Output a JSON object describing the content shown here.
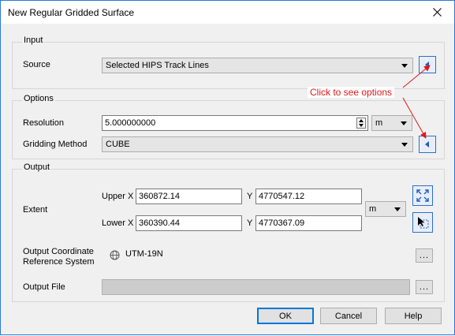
{
  "window": {
    "title": "New Regular Gridded Surface"
  },
  "input": {
    "group_title": "Input",
    "source_label": "Source",
    "source_value": "Selected HIPS Track Lines"
  },
  "options": {
    "group_title": "Options",
    "resolution_label": "Resolution",
    "resolution_value": "5.000000000",
    "resolution_unit": "m",
    "gridding_label": "Gridding Method",
    "gridding_value": "CUBE"
  },
  "annotation": {
    "text": "Click to see options"
  },
  "output": {
    "group_title": "Output",
    "extent_label": "Extent",
    "upper_x_label": "Upper X",
    "upper_x_value": "360872.14",
    "upper_y_label": "Y",
    "upper_y_value": "4770547.12",
    "lower_x_label": "Lower X",
    "lower_x_value": "360390.44",
    "lower_y_label": "Y",
    "lower_y_value": "4770367.09",
    "extent_unit": "m",
    "crs_label_1": "Output Coordinate",
    "crs_label_2": "Reference System",
    "crs_value": "UTM-19N",
    "browse_label": "...",
    "file_label": "Output File",
    "file_value": "",
    "file_browse_label": "..."
  },
  "buttons": {
    "ok": "OK",
    "cancel": "Cancel",
    "help": "Help"
  },
  "colors": {
    "annotation_red": "#e01818",
    "accent_blue": "#1f5fbf"
  }
}
